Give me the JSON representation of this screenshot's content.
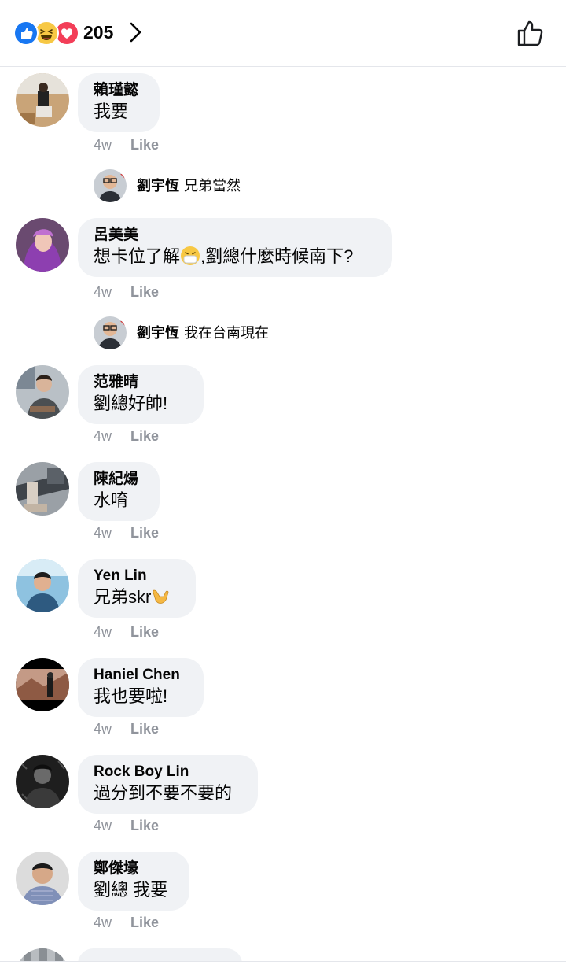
{
  "header": {
    "reaction_count": "205",
    "reaction_icons": [
      "like-reaction-icon",
      "haha-reaction-icon",
      "love-reaction-icon"
    ],
    "colors": {
      "like": "#1877f2",
      "haha": "#f7c844",
      "love": "#f33e58"
    }
  },
  "comments": [
    {
      "author": "賴瑾懿",
      "text": "我要",
      "time": "4w",
      "like": "Like",
      "reply": {
        "author": "劉宇恆",
        "text": "兄弟當然"
      }
    },
    {
      "author": "呂美美",
      "text_before": "想卡位了解",
      "emoji": "smiling-face-with-medical-mask-emoji",
      "text_after": ",劉總什麼時候南下?",
      "time": "4w",
      "like": "Like",
      "reply": {
        "author": "劉宇恆",
        "text": "我在台南現在"
      }
    },
    {
      "author": "范雅晴",
      "text": "劉總好帥!",
      "time": "4w",
      "like": "Like"
    },
    {
      "author": "陳紀煬",
      "text": "水唷",
      "time": "4w",
      "like": "Like"
    },
    {
      "author": "Yen Lin",
      "text": "兄弟skr",
      "emoji": "call-me-hand-emoji",
      "time": "4w",
      "like": "Like"
    },
    {
      "author": "Haniel Chen",
      "text": "我也要啦!",
      "time": "4w",
      "like": "Like"
    },
    {
      "author": "Rock Boy  Lin",
      "text": "過分到不要不要的",
      "time": "4w",
      "like": "Like"
    },
    {
      "author": "鄭傑壕",
      "text": "劉總 我要",
      "time": "4w",
      "like": "Like"
    }
  ]
}
